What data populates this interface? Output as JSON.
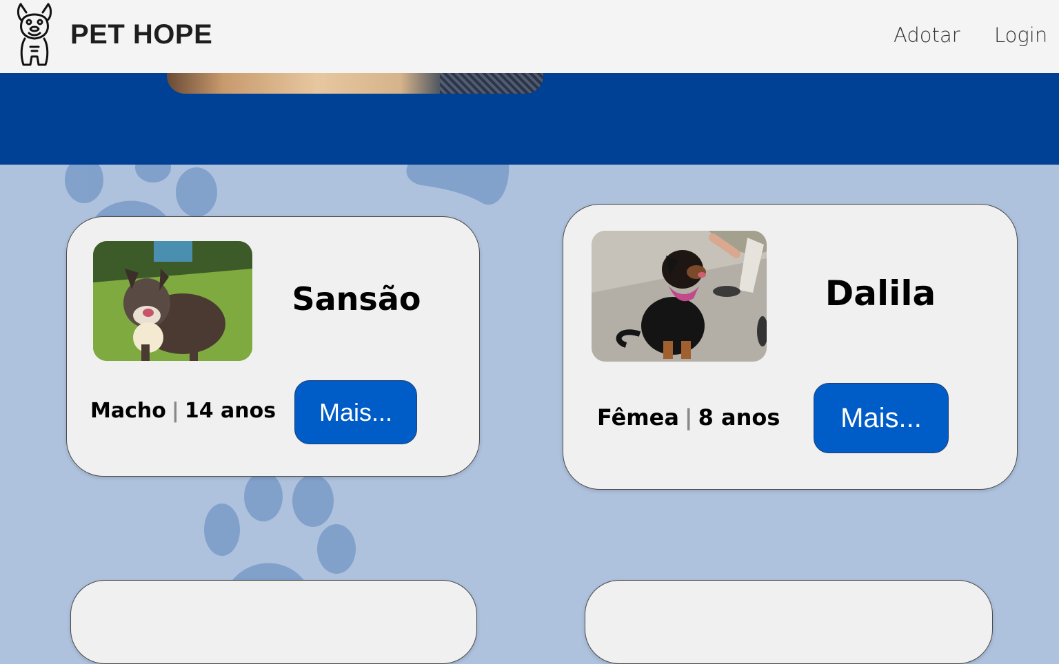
{
  "header": {
    "brand": "PET HOPE",
    "logo_icon": "bulldog-icon",
    "nav": [
      {
        "label": "Adotar"
      },
      {
        "label": "Login"
      }
    ]
  },
  "colors": {
    "header_bg": "#f4f4f4",
    "hero_bg": "#004095",
    "page_bg": "#aec2de",
    "paw": "#7a9cc8",
    "card_bg": "#f0f0f0",
    "button_bg": "#005cc7"
  },
  "pets": [
    {
      "name": "Sansão",
      "sex": "Macho",
      "age": "14 anos",
      "button_label": "Mais..."
    },
    {
      "name": "Dalila",
      "sex": "Fêmea",
      "age": "8 anos",
      "button_label": "Mais..."
    }
  ]
}
